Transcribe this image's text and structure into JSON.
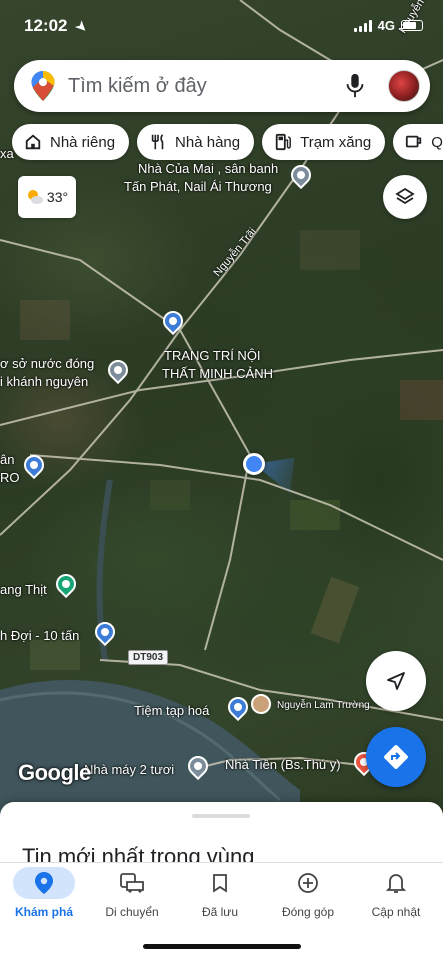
{
  "status_bar": {
    "time": "12:02",
    "network": "4G"
  },
  "search": {
    "placeholder": "Tìm kiếm ở đây"
  },
  "chips": [
    {
      "label": "Nhà riêng",
      "icon": "home-icon"
    },
    {
      "label": "Nhà hàng",
      "icon": "restaurant-icon"
    },
    {
      "label": "Trạm xăng",
      "icon": "gas-station-icon"
    },
    {
      "label": "Qu",
      "icon": "coffee-icon"
    }
  ],
  "weather": {
    "temperature": "33°",
    "icon": "partly-cloudy-icon"
  },
  "map": {
    "labels": {
      "place_1_line1": "Nhà Của Mai , sân banh",
      "place_1_line2": "Tấn Phát, Nail Ái Thương",
      "road_1": "Nguyễn Trãi",
      "place_2_line1": "TRANG TRÍ NỘI",
      "place_2_line2": "THẤT MINH CẢNH",
      "place_3_line1": "ơ sở nước đóng",
      "place_3_line2": "i khánh nguyên",
      "place_4_line1": "ân",
      "place_4_line2": "RO",
      "place_5": "ang Thịt",
      "place_6": "h Đợi - 10 tấn",
      "road_badge": "DT903",
      "place_7": "Tiệm tạp hoá",
      "place_8": "Nguyễn Lam Trường",
      "place_9": "Nhà máy 2 tươi",
      "place_10": "Nhà Tiền (Bs.Thú y)",
      "corner_top_left": "xa",
      "corner_top_right": "Nguyễn"
    },
    "logo": "Google"
  },
  "sheet": {
    "title": "Tin mới nhất trong vùng"
  },
  "tabs": [
    {
      "label": "Khám phá",
      "icon": "explore-pin-icon",
      "active": true
    },
    {
      "label": "Di chuyển",
      "icon": "commute-car-icon"
    },
    {
      "label": "Đã lưu",
      "icon": "bookmark-icon"
    },
    {
      "label": "Đóng góp",
      "icon": "add-circle-icon"
    },
    {
      "label": "Cập nhật",
      "icon": "bell-icon"
    }
  ],
  "colors": {
    "accent": "#1a73e8",
    "active_tab_bg": "#d2e3fc",
    "location_dot": "#4285f4"
  }
}
